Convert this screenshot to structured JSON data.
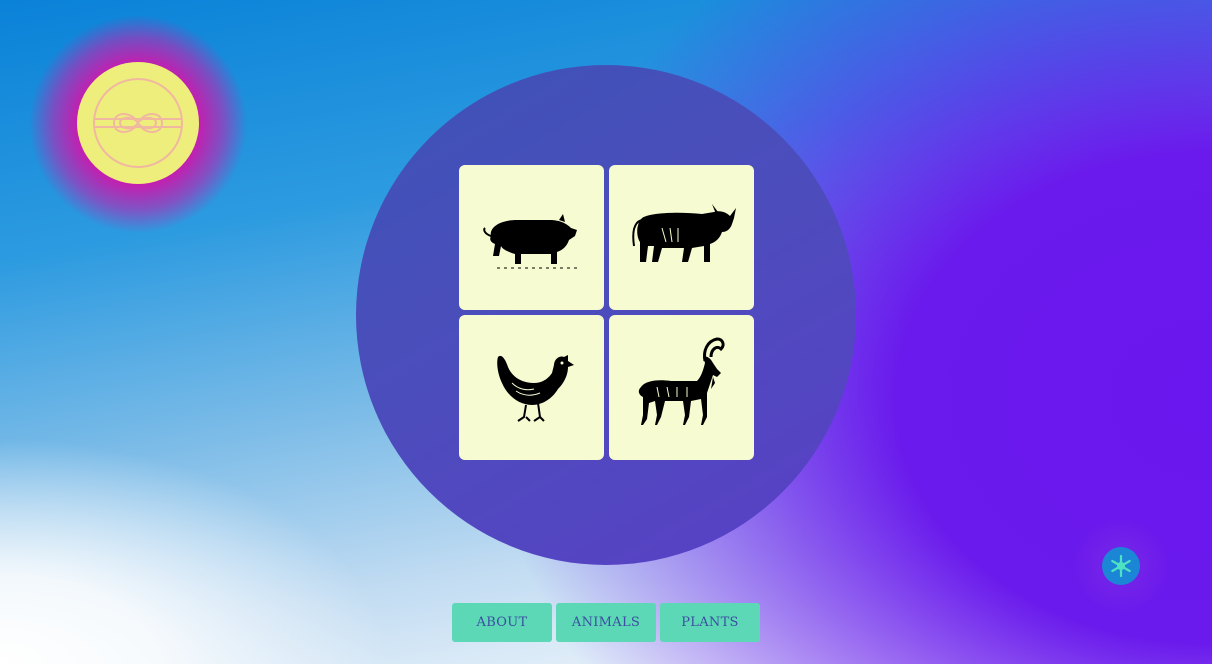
{
  "logo": {
    "icon": "knot-logo-icon",
    "colors": {
      "fill": "#eeee7c",
      "glow": "#e21fb3",
      "line": "#f0b8a0"
    }
  },
  "gallery": {
    "tiles": [
      {
        "animal": "pig",
        "icon": "pig-icon"
      },
      {
        "animal": "bull",
        "icon": "bull-icon"
      },
      {
        "animal": "hen",
        "icon": "hen-icon"
      },
      {
        "animal": "goat",
        "icon": "goat-icon"
      }
    ],
    "colors": {
      "tile": "#f7fbd2",
      "circle": "#4c4dbc"
    }
  },
  "nav": {
    "about_label": "ABOUT",
    "animals_label": "ANIMALS",
    "plants_label": "PLANTS",
    "colors": {
      "button": "#5cd8b6",
      "text": "#3b4fa0"
    }
  },
  "help": {
    "icon": "snowflake-icon",
    "color": "#1b86d6"
  }
}
